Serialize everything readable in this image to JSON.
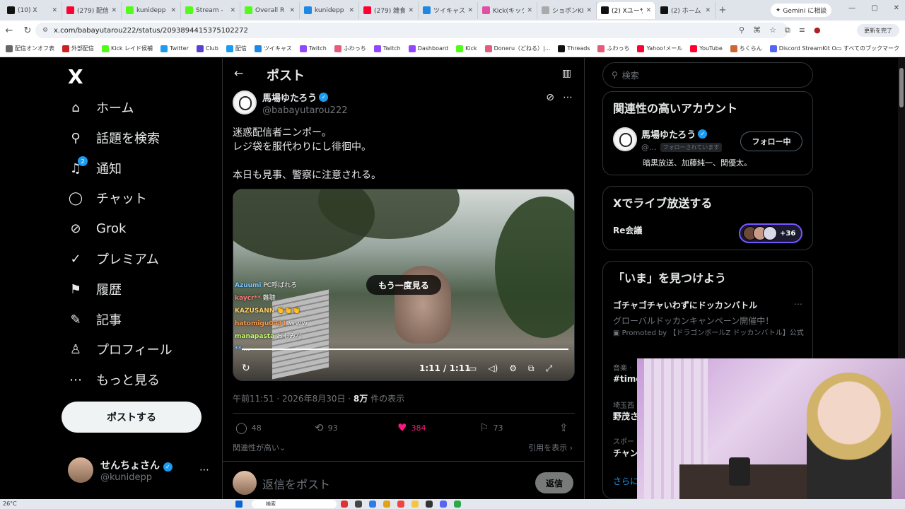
{
  "browser": {
    "tabs": [
      {
        "title": "(10) X",
        "color": "#111111"
      },
      {
        "title": "(279) 配信",
        "color": "#ff0033"
      },
      {
        "title": "kunidepp",
        "color": "#53fc18"
      },
      {
        "title": "Stream - ",
        "color": "#53fc18"
      },
      {
        "title": "Overall R",
        "color": "#53fc18"
      },
      {
        "title": "kunidepp",
        "color": "#1e88e5"
      },
      {
        "title": "(279) 雑食",
        "color": "#ff0033"
      },
      {
        "title": "ツイキャス",
        "color": "#1e88e5"
      },
      {
        "title": "Kick(キック",
        "color": "#e04fa0"
      },
      {
        "title": "ショボンKICK",
        "color": "#aaaaaa"
      },
      {
        "title": "(2) Xユーザ",
        "color": "#111111",
        "active": true
      },
      {
        "title": "(2) ホーム /",
        "color": "#111111"
      }
    ],
    "gemini_label": "Gemini に相談",
    "url": "x.com/babayutarou222/status/2093894415375102272",
    "update_label": "更新を完了",
    "bookmarks": [
      {
        "label": "配信オンオフ表",
        "color": "#666666"
      },
      {
        "label": "外部配信",
        "color": "#cc2222"
      },
      {
        "label": "Kick レイド候補",
        "color": "#53fc18"
      },
      {
        "label": "Twitter",
        "color": "#1d9bf0"
      },
      {
        "label": "Club",
        "color": "#5b3fd1"
      },
      {
        "label": "配信",
        "color": "#1d9bf0"
      },
      {
        "label": "ツイキャス",
        "color": "#1e88e5"
      },
      {
        "label": "Twitch",
        "color": "#9146ff"
      },
      {
        "label": "ふわっち",
        "color": "#e65a7a"
      },
      {
        "label": "Twitch",
        "color": "#9146ff"
      },
      {
        "label": "Dashboard",
        "color": "#9146ff"
      },
      {
        "label": "Kick",
        "color": "#53fc18"
      },
      {
        "label": "Doneru（どねる）|...",
        "color": "#e65a7a"
      },
      {
        "label": "Threads",
        "color": "#111111"
      },
      {
        "label": "ふわっち",
        "color": "#e65a7a"
      },
      {
        "label": "Yahoo!メール",
        "color": "#ff0033"
      },
      {
        "label": "YouTube",
        "color": "#ff0033"
      },
      {
        "label": "ちくらん",
        "color": "#cc6633"
      },
      {
        "label": "Discord StreamKit O...",
        "color": "#5865f2"
      }
    ],
    "all_bookmarks": "すべてのブックマーク"
  },
  "nav": {
    "logo": "X",
    "items": [
      {
        "label": "ホーム",
        "icon": "⌂",
        "name": "home"
      },
      {
        "label": "話題を検索",
        "icon": "⚲",
        "name": "explore"
      },
      {
        "label": "通知",
        "icon": "♫",
        "name": "notifications",
        "badge": "2"
      },
      {
        "label": "チャット",
        "icon": "◯",
        "name": "chat"
      },
      {
        "label": "Grok",
        "icon": "⊘",
        "name": "grok"
      },
      {
        "label": "プレミアム",
        "icon": "✓",
        "name": "premium"
      },
      {
        "label": "履歴",
        "icon": "⚑",
        "name": "history"
      },
      {
        "label": "記事",
        "icon": "✎",
        "name": "articles"
      },
      {
        "label": "プロフィール",
        "icon": "♙",
        "name": "profile"
      },
      {
        "label": "もっと見る",
        "icon": "⋯",
        "name": "more"
      }
    ],
    "post_button": "ポストする",
    "me": {
      "name": "せんちょさん",
      "handle": "@kunidepp"
    }
  },
  "main": {
    "header_title": "ポスト",
    "author": {
      "name": "馬場ゆたろう",
      "handle": "@babayutarou222"
    },
    "text": "迷惑配信者ニンポー。\nレジ袋を服代わりにし徘徊中。\n\n本日も見事、警察に注意される。",
    "video": {
      "replay_label": "もう一度見る",
      "time": "1:11 / 1:11",
      "progress": 1.0,
      "chat": [
        {
          "user": "Azuumi",
          "msg": "PC呼ばれろ",
          "color": "#7ec8ff"
        },
        {
          "user": "kaycr**",
          "msg": "難聴",
          "color": "#ff7a7a"
        },
        {
          "user": "KAZUSANN",
          "msg": "👏👏👏",
          "color": "#ffd26a"
        },
        {
          "user": "hatomigu0431",
          "msg": "ｗｗｗ",
          "color": "#ff9a4a"
        },
        {
          "user": "manapasta",
          "msg": "おもみな",
          "color": "#c7ff6a"
        },
        {
          "user": "**",
          "msg": "…",
          "color": "#7ec8ff"
        }
      ]
    },
    "meta": {
      "time": "午前11:51 · 2026年8月30日 · ",
      "views": "8万",
      "views_suffix": " 件の表示"
    },
    "actions": {
      "replies": "48",
      "reposts": "93",
      "likes": "384",
      "bookmarks": "73"
    },
    "relevance_label": "関連性が高い",
    "quotes_label": "引用を表示",
    "reply_placeholder": "返信をポスト",
    "reply_button": "返信"
  },
  "sidebar": {
    "search_placeholder": "検索",
    "related": {
      "title": "関連性の高いアカウント",
      "name": "馬場ゆたろう",
      "handle": "@...",
      "follows_you": "フォローされています",
      "follow_button": "フォロー中",
      "bio": "暗黒放送、加藤純一、関優太。"
    },
    "live": {
      "title": "Xでライブ放送する",
      "label": "Re会議",
      "count": "+36"
    },
    "trends": {
      "title": "「いま」を見つけよう",
      "t1": "ゴチャゴチャいわずにドッカンバトル",
      "t1_sub": "グローバルドッカンキャンペーン開催中！",
      "t1_promo": "Promoted by 【ドラゴンボールZ ドッカンバトル】公式",
      "t2_cat": "音楽 ·",
      "t2_name": "#time",
      "t3_cat": "埼玉西",
      "t3_name": "野茂さ",
      "t4_cat": "スポー",
      "t4_name": "チャン",
      "more": "さらに"
    }
  },
  "taskbar": {
    "temp": "26°C",
    "search": "検索"
  }
}
